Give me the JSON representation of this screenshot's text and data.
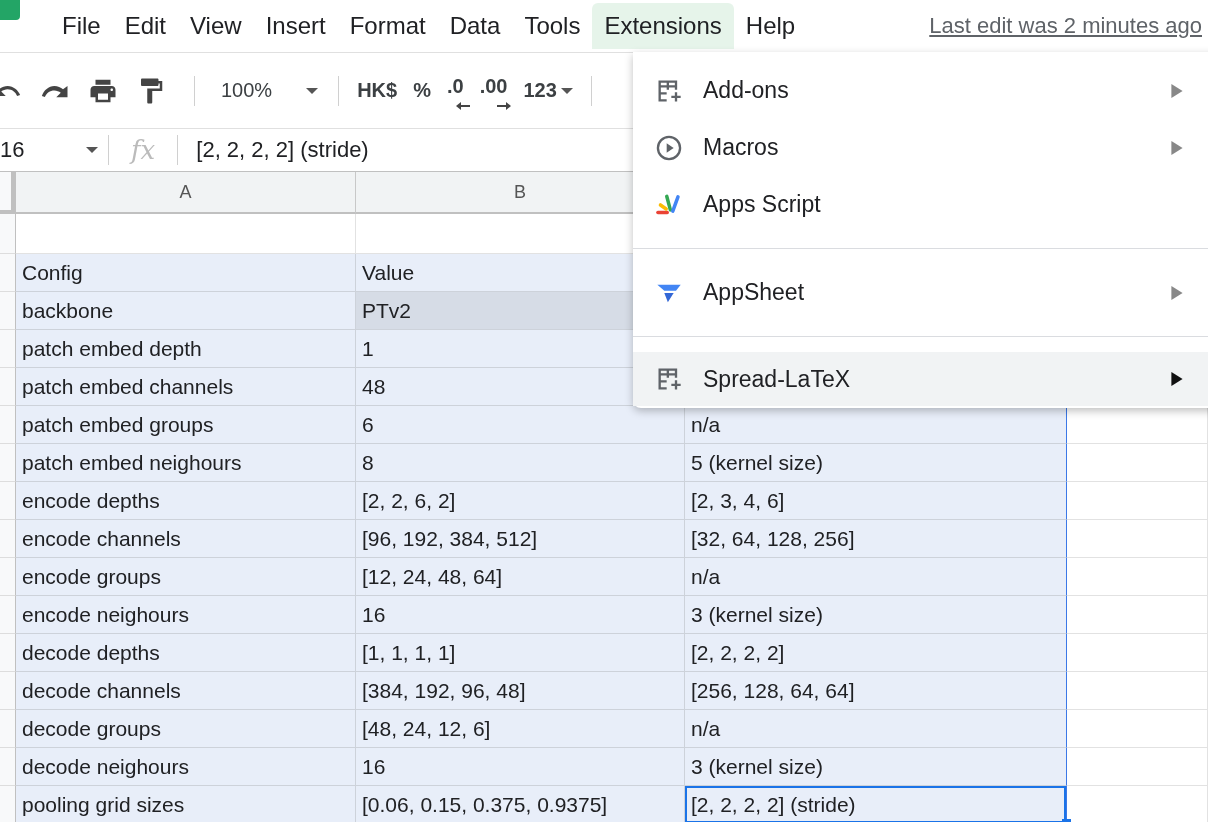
{
  "menubar": {
    "items": [
      {
        "label": "File",
        "selected": false
      },
      {
        "label": "Edit",
        "selected": false
      },
      {
        "label": "View",
        "selected": false
      },
      {
        "label": "Insert",
        "selected": false
      },
      {
        "label": "Format",
        "selected": false
      },
      {
        "label": "Data",
        "selected": false
      },
      {
        "label": "Tools",
        "selected": false
      },
      {
        "label": "Extensions",
        "selected": true
      },
      {
        "label": "Help",
        "selected": false
      }
    ],
    "last_edit": "Last edit was 2 minutes ago"
  },
  "toolbar": {
    "zoom": "100%",
    "currency": "HK$",
    "percent": "%",
    "decrease_decimals": ".0",
    "increase_decimals": ".00",
    "number_format": "123"
  },
  "formula_bar": {
    "cell_ref": "16",
    "fx": "fx",
    "value": "[2, 2, 2, 2] (stride)"
  },
  "columns": [
    "A",
    "B"
  ],
  "rows": [
    {
      "a": "Config",
      "b": "Value",
      "shaded": false,
      "active": false
    },
    {
      "a": "backbone",
      "b": "PTv2",
      "shaded": true,
      "active": false
    },
    {
      "a": "patch embed depth",
      "b": "1",
      "shaded": false,
      "active": false
    },
    {
      "a": "patch embed channels",
      "b": "48",
      "shaded": false,
      "active": false
    },
    {
      "a": "patch embed groups",
      "b": "6",
      "c": "n/a",
      "shaded": false,
      "active": false
    },
    {
      "a": "patch embed neighours",
      "b": "8",
      "c": "5 (kernel size)",
      "shaded": false,
      "active": false
    },
    {
      "a": "encode depths",
      "b": "[2, 2, 6, 2]",
      "c": "[2, 3, 4, 6]",
      "shaded": false,
      "active": false
    },
    {
      "a": "encode channels",
      "b": "[96, 192, 384, 512]",
      "c": "[32, 64, 128, 256]",
      "shaded": false,
      "active": false
    },
    {
      "a": "encode groups",
      "b": "[12, 24, 48, 64]",
      "c": "n/a",
      "shaded": false,
      "active": false
    },
    {
      "a": "encode neighours",
      "b": "16",
      "c": "3 (kernel size)",
      "shaded": false,
      "active": false
    },
    {
      "a": "decode depths",
      "b": "[1, 1, 1, 1]",
      "c": "[2, 2, 2, 2]",
      "shaded": false,
      "active": false
    },
    {
      "a": "decode channels",
      "b": "[384, 192, 96, 48]",
      "c": "[256, 128, 64, 64]",
      "shaded": false,
      "active": false
    },
    {
      "a": "decode groups",
      "b": "[48, 24, 12, 6]",
      "c": "n/a",
      "shaded": false,
      "active": false
    },
    {
      "a": "decode neighours",
      "b": "16",
      "c": "3 (kernel size)",
      "shaded": false,
      "active": false
    },
    {
      "a": "pooling grid sizes",
      "b": "[0.06, 0.15, 0.375, 0.9375]",
      "c": "[2, 2, 2, 2] (stride)",
      "shaded": false,
      "active": true
    }
  ],
  "menu": {
    "groups": [
      [
        {
          "label": "Add-ons",
          "submenu": true,
          "selected": false
        },
        {
          "label": "Macros",
          "submenu": true,
          "selected": false
        },
        {
          "label": "Apps Script",
          "submenu": false,
          "selected": false
        }
      ],
      [
        {
          "label": "AppSheet",
          "submenu": true,
          "selected": false
        }
      ],
      [
        {
          "label": "Spread-LaTeX",
          "submenu": true,
          "selected": true
        }
      ]
    ]
  }
}
